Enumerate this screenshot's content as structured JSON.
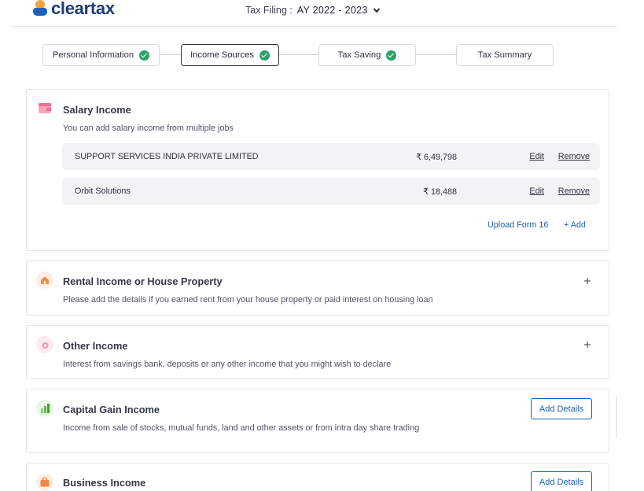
{
  "header": {
    "logo_text": "cleartax",
    "tax_filing_label": "Tax Filing :",
    "assessment_year": "AY 2022 - 2023"
  },
  "stepper": {
    "steps": [
      {
        "label": "Personal Information",
        "completed": true,
        "active": false
      },
      {
        "label": "Income Sources",
        "completed": true,
        "active": true
      },
      {
        "label": "Tax Saving",
        "completed": true,
        "active": false
      },
      {
        "label": "Tax Summary",
        "completed": false,
        "active": false
      }
    ]
  },
  "salary": {
    "title": "Salary Income",
    "description": "You can add salary income from multiple jobs",
    "rows": [
      {
        "name": "SUPPORT SERVICES INDIA PRIVATE LIMITED",
        "amount": "₹ 6,49,798",
        "edit": "Edit",
        "remove": "Remove"
      },
      {
        "name": "Orbit Solutions",
        "amount": "₹ 18,488",
        "edit": "Edit",
        "remove": "Remove"
      }
    ],
    "upload_label": "Upload Form 16",
    "add_label": "+ Add"
  },
  "rental": {
    "title": "Rental Income or House Property",
    "description": "Please add the details if you earned rent from your house property or paid interest on housing loan"
  },
  "other": {
    "title": "Other Income",
    "description": "Interest from savings bank, deposits or any other income that you might wish to declare"
  },
  "capital": {
    "title": "Capital Gain Income",
    "description": "Income from sale of stocks, mutual funds, land and other assets or from intra day share trading",
    "button": "Add Details"
  },
  "business": {
    "title": "Business Income",
    "button": "Add Details"
  },
  "colors": {
    "accent_blue": "#1f5fa8",
    "success_green": "#2aa46a",
    "brand_navy": "#1d3c78"
  }
}
